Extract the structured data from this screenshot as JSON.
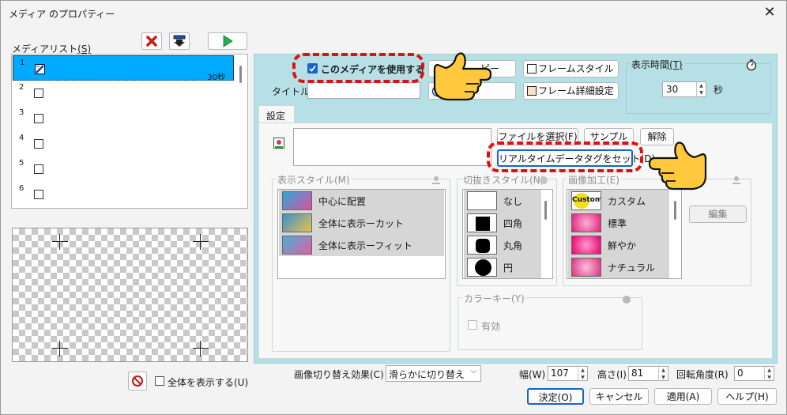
{
  "window": {
    "title": "メディア のプロパティー",
    "close_glyph": "✕"
  },
  "media_list": {
    "label": "メディアリスト",
    "shortcut": "(S)",
    "items": [
      {
        "num": "1",
        "duration": "30秒",
        "selected": true
      },
      {
        "num": "2",
        "duration": ""
      },
      {
        "num": "3",
        "duration": ""
      },
      {
        "num": "4",
        "duration": ""
      },
      {
        "num": "5",
        "duration": ""
      },
      {
        "num": "6",
        "duration": ""
      }
    ]
  },
  "toolbar": {
    "delete_icon": "red-x-icon",
    "download_icon": "arrow-down-icon",
    "play_icon": "play-icon"
  },
  "use_media": {
    "label": "このメディアを使用する",
    "checked": true
  },
  "copy_button": "ピー",
  "frame_style_button": "フレームスタイル",
  "frame_detail_button": "フレーム詳細設定",
  "title_field": {
    "label": "タイトル",
    "value": ""
  },
  "display_time": {
    "label": "表示時間",
    "shortcut": "(T)",
    "value": "30",
    "unit": "秒"
  },
  "tab": {
    "label": "設定"
  },
  "file_buttons": {
    "select": "ファイルを選択(F)",
    "sample": "サンプル",
    "clear": "解除",
    "realtime_tag": "リアルタイムデータタグをセット(D)"
  },
  "display_style": {
    "label": "表示スタイル(M)",
    "items": [
      "中心に配置",
      "全体に表示ーカット",
      "全体に表示ーフィット"
    ]
  },
  "crop_style": {
    "label": "切抜きスタイル(N)",
    "items": [
      "なし",
      "四角",
      "丸角",
      "円"
    ]
  },
  "image_processing": {
    "label": "画像加工(E)",
    "items": [
      "カスタム",
      "標準",
      "鮮やか",
      "ナチュラル"
    ],
    "custom_badge": "Custom",
    "edit_button": "編集"
  },
  "color_key": {
    "label": "カラーキー(Y)",
    "checkbox_label": "有効"
  },
  "show_all": {
    "label": "全体を表示する(U)"
  },
  "transition": {
    "label": "画像切り替え効果(C)",
    "value": "滑らかに切り替え"
  },
  "dimensions": {
    "width_label": "幅(W)",
    "width_value": "107",
    "height_label": "高さ(I)",
    "height_value": "81",
    "rotation_label": "回転角度(R)",
    "rotation_value": "0"
  },
  "footer": {
    "ok": "決定(O)",
    "cancel": "キャンセル",
    "apply": "適用(A)",
    "help": "ヘルプ(H)"
  },
  "colors": {
    "selection": "#00aaff",
    "panel": "#b7e0e6",
    "highlight_ring": "#e01010",
    "hand": "#ffc83d"
  }
}
